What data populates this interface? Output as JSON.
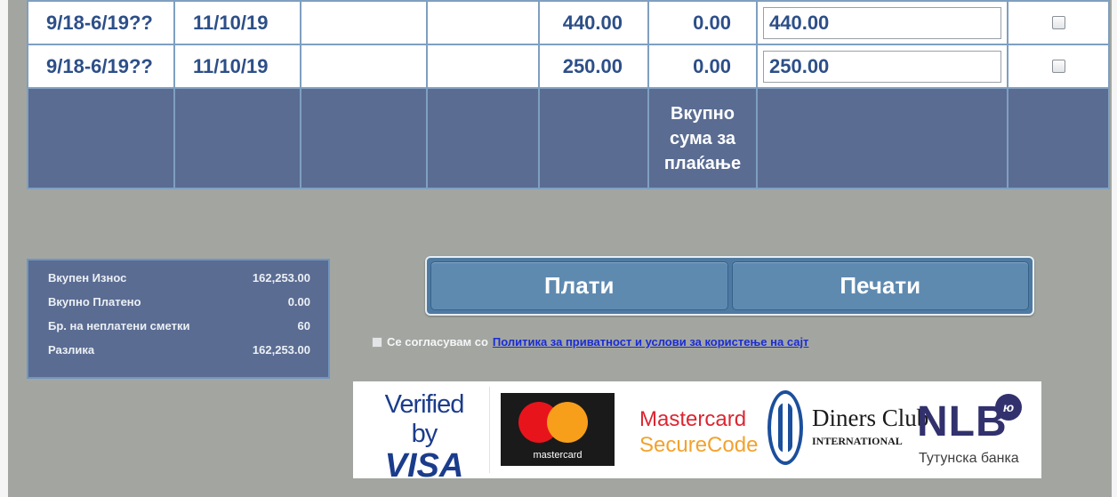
{
  "rows": [
    {
      "period": "9/18-6/19??",
      "date": "11/10/19",
      "col3": "",
      "col4": "",
      "amount": "440.00",
      "paid": "0.00",
      "pay_value": "440.00"
    },
    {
      "period": "9/18-6/19??",
      "date": "11/10/19",
      "col3": "",
      "col4": "",
      "amount": "250.00",
      "paid": "0.00",
      "pay_value": "250.00"
    }
  ],
  "total_row": {
    "label_line1": "Вкупно",
    "label_line2": "сума за",
    "label_line3": "плаќање"
  },
  "summary": {
    "total_amount_label": "Вкупен Износ",
    "total_amount_value": "162,253.00",
    "total_paid_label": "Вкупно Платено",
    "total_paid_value": "0.00",
    "unpaid_label": "Бр. на неплатени сметки",
    "unpaid_value": "60",
    "difference_label": "Разлика",
    "difference_value": "162,253.00"
  },
  "buttons": {
    "pay": "Плати",
    "print": "Печати"
  },
  "agreement": {
    "text": "Се согласувам со",
    "link": "Политика за приватност и услови за користење на сајт"
  },
  "logos": {
    "visa_line1": "Verified by",
    "visa_line2": "VISA",
    "mastercard": "mastercard",
    "securecode_line1": "Mastercard",
    "securecode_line2": "SecureCode",
    "diners_line1": "Diners Club",
    "diners_line2": "INTERNATIONAL",
    "nlb": "NLB",
    "nlb_badge": "ю",
    "nlb_sub": "Тутунска банка"
  },
  "colors": {
    "table_header_blue": "#5a6c92",
    "text_blue": "#2d4f88",
    "button_blue": "#5f8ab0",
    "link_blue": "#1a2cd4"
  }
}
